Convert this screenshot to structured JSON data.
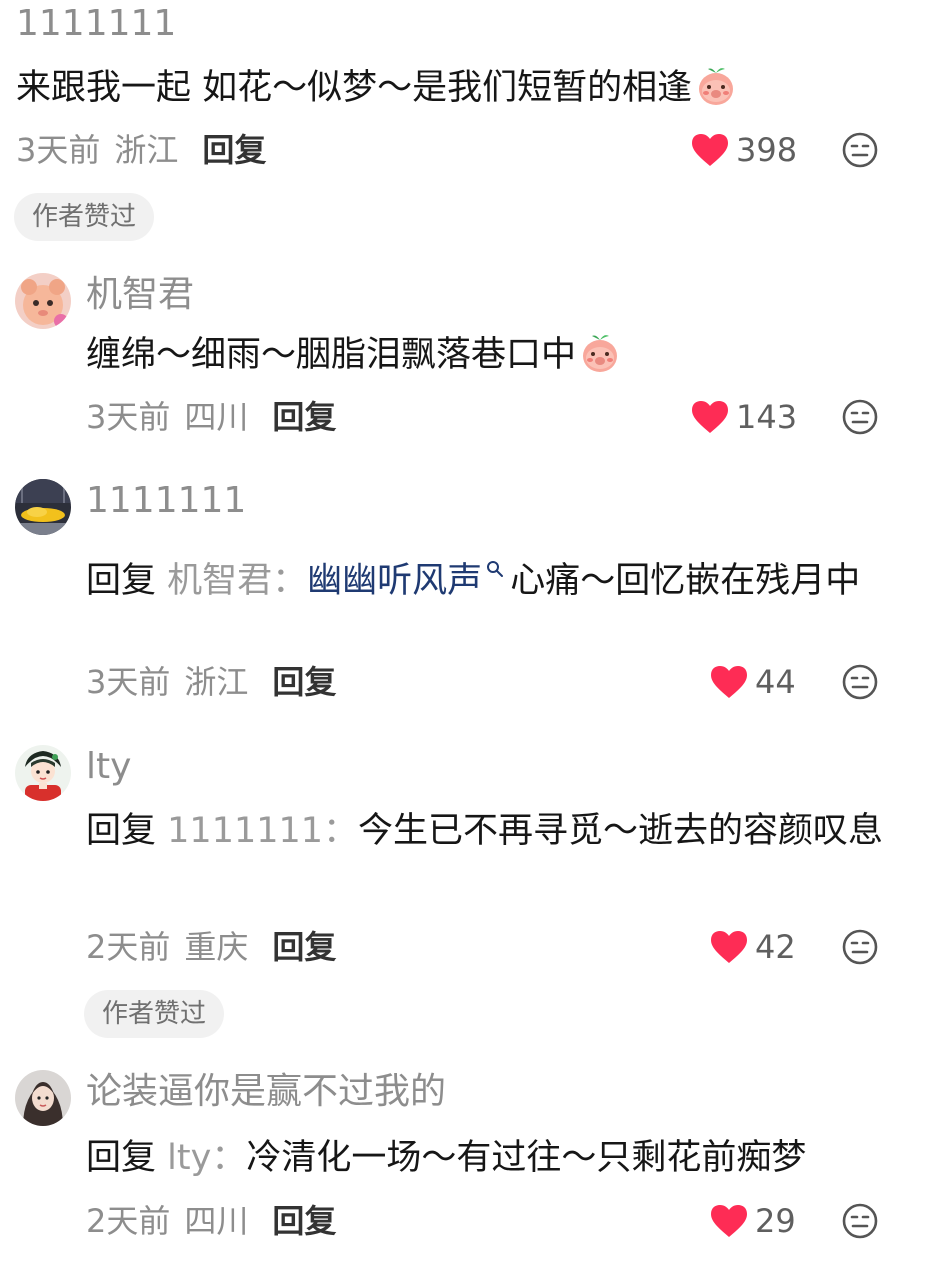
{
  "comments": [
    {
      "username": "1111111",
      "text": "来跟我一起 如花～似梦～是我们短暂的相逢",
      "emoji": "peach-shy-emoji",
      "time": "3天前",
      "location": "浙江",
      "reply_label": "回复",
      "likes": "398",
      "author_liked": "作者赞过"
    },
    {
      "username": "机智君",
      "text": "缠绵～细雨～胭脂泪飘落巷口中",
      "emoji": "peach-shy-emoji",
      "time": "3天前",
      "location": "四川",
      "reply_label": "回复",
      "likes": "143"
    },
    {
      "username": "1111111",
      "reply_word": "回复",
      "reply_to": "机智君：",
      "mention": "幽幽听风声",
      "text": "心痛～回忆嵌在残月中",
      "time": "3天前",
      "location": "浙江",
      "reply_label": "回复",
      "likes": "44"
    },
    {
      "username": "lty",
      "reply_word": "回复",
      "reply_to": "1111111：",
      "text": "今生已不再寻觅～逝去的容颜叹息",
      "time": "2天前",
      "location": "重庆",
      "reply_label": "回复",
      "likes": "42",
      "author_liked": "作者赞过"
    },
    {
      "username": "论装逼你是赢不过我的",
      "reply_word": "回复",
      "reply_to": "lty：",
      "text": "冷清化一场～有过往～只剩花前痴梦",
      "time": "2天前",
      "location": "四川",
      "reply_label": "回复",
      "likes": "29"
    }
  ],
  "colors": {
    "heart": "#fe2c55",
    "mention": "#1f3a72",
    "muted": "#8d8d8d"
  },
  "icons": {
    "like": "heart-icon",
    "emoji": "neutral-face-icon",
    "search": "search-icon"
  }
}
